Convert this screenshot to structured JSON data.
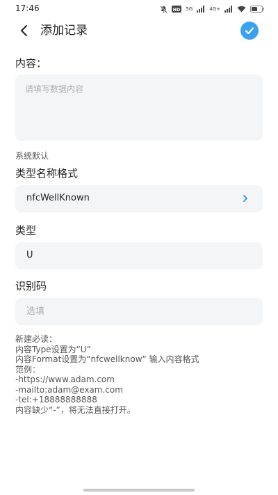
{
  "status_bar": {
    "time": "17:46",
    "net_label_1": "5G",
    "net_label_2": "4G+",
    "icons": [
      "mute-bell-icon",
      "hd-icon",
      "signal-icon",
      "wifi-icon",
      "battery-icon"
    ]
  },
  "header": {
    "title": "添加记录",
    "back_icon": "chevron-left-icon",
    "confirm_icon": "check-icon",
    "accent_color": "#3aa1ef"
  },
  "content": {
    "label": "内容：",
    "placeholder": "请填写数据内容",
    "value": ""
  },
  "system_default_label": "系统默认",
  "type_name_format": {
    "label": "类型名称格式",
    "value": "nfcWellKnown",
    "chevron_color": "#3aa1ef"
  },
  "type": {
    "label": "类型",
    "value": "U"
  },
  "identifier": {
    "label": "识别码",
    "placeholder": "选填",
    "value": ""
  },
  "notes": {
    "lines": [
      "新建必读：",
      "内容Type设置为“U”",
      "内容Format设置为“nfcwellknow” 输入内容格式",
      "范例：",
      "-https://www.adam.com",
      "-mailto:adam@exam.com",
      "-tel:+18888888888",
      "内容缺少“-”，将无法直接打开。"
    ]
  }
}
